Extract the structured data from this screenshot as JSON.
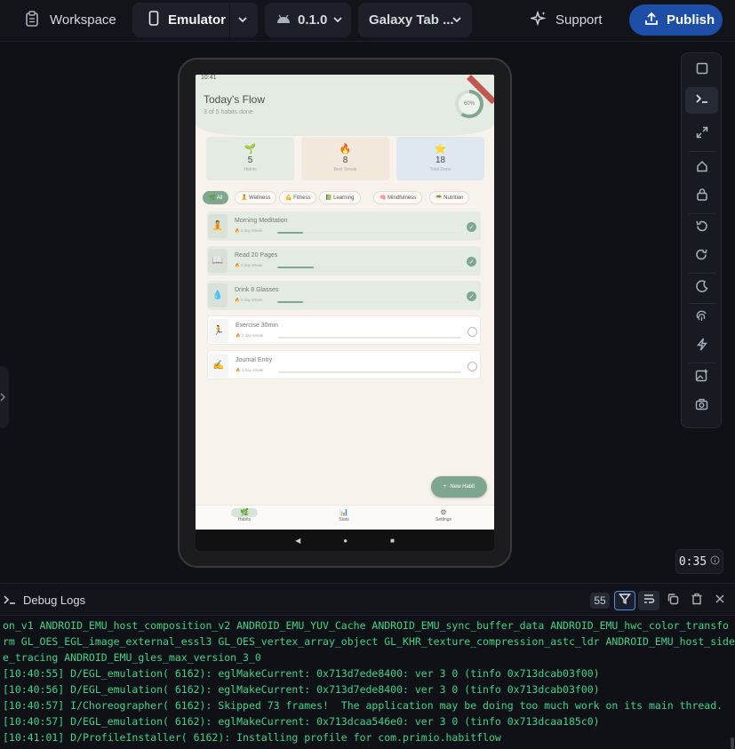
{
  "topbar": {
    "workspace_label": "Workspace",
    "emulator_label": "Emulator",
    "version_label": "0.1.0",
    "device_label": "Galaxy Tab ...",
    "support_label": "Support",
    "publish_label": "Publish"
  },
  "app": {
    "status_time": "10:41",
    "title": "Today's Flow",
    "subtitle": "3 of 5 habits done",
    "progress_label": "60%",
    "progress_value": 0.6,
    "stats": [
      {
        "icon": "🌱",
        "value": "5",
        "label": "Habits",
        "color": "#e3ebe2"
      },
      {
        "icon": "🔥",
        "value": "8",
        "label": "Best Streak",
        "color": "#f3e8dc"
      },
      {
        "icon": "⭐",
        "value": "18",
        "label": "Total Done",
        "color": "#dfe8f1"
      }
    ],
    "chips": [
      {
        "label": "🌿 All",
        "active": true
      },
      {
        "label": "🧘 Wellness",
        "active": false
      },
      {
        "label": "💪 Fitness",
        "active": false
      },
      {
        "label": "📗 Learning",
        "active": false
      },
      {
        "label": "🧠 Mindfulness",
        "active": false
      },
      {
        "label": "🥗 Nutrition",
        "active": false
      }
    ],
    "habits": [
      {
        "icon": "🧘",
        "name": "Morning Meditation",
        "streak": "🔥 5 day streak",
        "progress": 0.14,
        "done": true
      },
      {
        "icon": "📖",
        "name": "Read 20 Pages",
        "streak": "🔥 3 day streak",
        "progress": 0.2,
        "done": true
      },
      {
        "icon": "💧",
        "name": "Drink 8 Glasses",
        "streak": "🔥 8 day streak",
        "progress": 0.14,
        "done": true
      },
      {
        "icon": "🏃",
        "name": "Exercise 30min",
        "streak": "🔥 2 day streak",
        "progress": 0,
        "done": false
      },
      {
        "icon": "✍️",
        "name": "Journal Entry",
        "streak": "🔥 1 day streak",
        "progress": 0,
        "done": false
      }
    ],
    "fab_label": "New Habit",
    "nav": [
      {
        "icon": "🌿",
        "label": "Habits",
        "active": true
      },
      {
        "icon": "📊",
        "label": "Stats",
        "active": false
      },
      {
        "icon": "⚙",
        "label": "Settings",
        "active": false
      }
    ]
  },
  "timer": "0:35",
  "debug": {
    "title": "Debug Logs",
    "count": "55",
    "lines": [
      {
        "text": "on_v1 ANDROID_EMU_host_composition_v2 ANDROID_EMU_YUV_Cache ANDROID_EMU_sync_buffer_data ANDROID_EMU_hwc_color_transfo",
        "green": true
      },
      {
        "text": "rm GL_OES_EGL_image_external_essl3 GL_OES_vertex_array_object GL_KHR_texture_compression_astc_ldr ANDROID_EMU_host_side",
        "green": true
      },
      {
        "text": "e_tracing ANDROID_EMU_gles_max_version_3_0",
        "green": true
      },
      {
        "text": "[10:40:55] D/EGL_emulation( 6162): eglMakeCurrent: 0x713d7ede8400: ver 3 0 (tinfo 0x713dcab03f00)",
        "green": true
      },
      {
        "text": "[10:40:56] D/EGL_emulation( 6162): eglMakeCurrent: 0x713d7ede8400: ver 3 0 (tinfo 0x713dcab03f00)",
        "green": true
      },
      {
        "text": "[10:40:57] I/Choreographer( 6162): Skipped 73 frames!  The application may be doing too much work on its main thread.",
        "green": true
      },
      {
        "text": "[10:40:57] D/EGL_emulation( 6162): eglMakeCurrent: 0x713dcaa546e0: ver 3 0 (tinfo 0x713dcaa185c0)",
        "green": true
      },
      {
        "text": "[10:41:01] D/ProfileInstaller( 6162): Installing profile for com.primio.habitflow",
        "green": true
      }
    ]
  },
  "colors": {
    "accent": "#1e4fa8",
    "sage": "#7fa790",
    "log_green": "#3fd48a"
  }
}
